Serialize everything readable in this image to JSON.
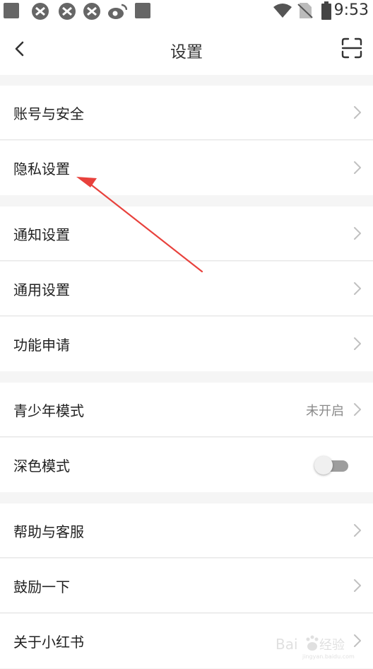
{
  "status_bar": {
    "time": "9:53",
    "icons": [
      "notification-square-icon",
      "app-icon",
      "app-icon",
      "app-icon",
      "weibo-icon",
      "notification-square-icon",
      "wifi-icon",
      "no-sim-icon",
      "battery-icon"
    ]
  },
  "header": {
    "title": "设置",
    "back_icon": "chevron-left-icon",
    "scan_icon": "scan-icon"
  },
  "groups": [
    {
      "items": [
        {
          "label": "账号与安全"
        },
        {
          "label": "隐私设置"
        }
      ]
    },
    {
      "items": [
        {
          "label": "通知设置"
        },
        {
          "label": "通用设置"
        },
        {
          "label": "功能申请"
        }
      ]
    },
    {
      "items": [
        {
          "label": "青少年模式",
          "value": "未开启"
        },
        {
          "label": "深色模式",
          "toggle": false
        }
      ]
    },
    {
      "items": [
        {
          "label": "帮助与客服"
        },
        {
          "label": "鼓励一下"
        },
        {
          "label": "关于小红书"
        }
      ]
    }
  ],
  "annotation": {
    "color": "#e8413c",
    "target": "隐私设置"
  }
}
